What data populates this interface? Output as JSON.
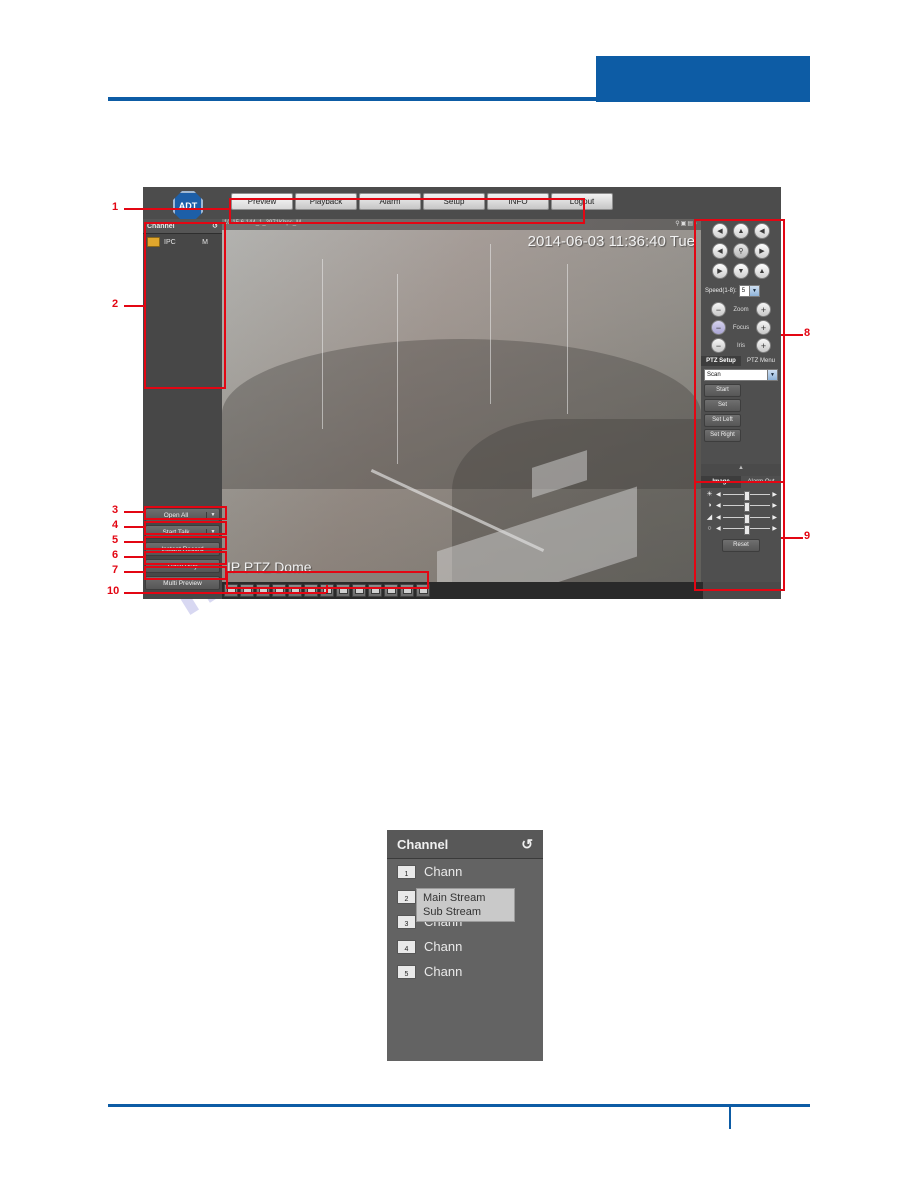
{
  "page": {
    "watermark": "manualslib.com"
  },
  "app": {
    "logo": "ADT",
    "tabs": [
      {
        "label": "Preview",
        "active": true
      },
      {
        "label": "Playback",
        "active": false
      },
      {
        "label": "Alarm",
        "active": false
      },
      {
        "label": "Setup",
        "active": false
      },
      {
        "label": "INFO",
        "active": false
      },
      {
        "label": "Logout",
        "active": false
      }
    ],
    "channel_panel": {
      "title": "Channel",
      "refresh_icon": "refresh-icon",
      "rows": [
        {
          "name": "IPC",
          "mode": "M"
        }
      ]
    },
    "left_buttons": [
      {
        "label": "Open All",
        "has_arrow": true
      },
      {
        "label": "Start Talk",
        "has_arrow": true
      },
      {
        "label": "Instant Record",
        "has_arrow": false
      },
      {
        "label": "Local Play",
        "has_arrow": false
      },
      {
        "label": "Multi Preview",
        "has_arrow": false
      }
    ],
    "video": {
      "stream_id": "10.15.6.144_1_3971Kbps_M",
      "timestamp": "2014-06-03 11:36:40 Tue",
      "camera_name": "IP PTZ Dome",
      "control_icons": "search-icon zoom-icon record-icon audio-icon"
    },
    "layout_toolbar": {
      "icons": [
        "single-window-icon",
        "dual-window-icon",
        "fullscreen-icon",
        "one-split-icon",
        "four-split-icon",
        "six-split-icon",
        "eight-split-icon",
        "nine-split-icon",
        "thirteen-split-icon",
        "sixteen-split-icon",
        "twenty-split-icon",
        "twentyfive-split-icon",
        "thirtysix-split-icon"
      ]
    },
    "ptz": {
      "pad": [
        [
          "arrow-up-left-icon",
          "arrow-up-icon",
          "arrow-up-right-icon"
        ],
        [
          "arrow-left-icon",
          "zoom-area-icon",
          "arrow-right-icon"
        ],
        [
          "arrow-down-left-icon",
          "arrow-down-icon",
          "arrow-down-right-icon"
        ]
      ],
      "speed_label": "Speed(1-8):",
      "speed_value": "5",
      "controls": [
        {
          "label": "Zoom",
          "minus": "−",
          "plus": "+"
        },
        {
          "label": "Focus",
          "minus": "−",
          "plus": "+"
        },
        {
          "label": "Iris",
          "minus": "−",
          "plus": "+"
        }
      ],
      "tabs": [
        {
          "label": "PTZ Setup",
          "active": true
        },
        {
          "label": "PTZ Menu",
          "active": false
        }
      ],
      "function_value": "Scan",
      "buttons": [
        "Start",
        "Set",
        "Set Left",
        "Set Right"
      ]
    },
    "image_panel": {
      "tabs": [
        {
          "label": "Image",
          "active": true
        },
        {
          "label": "Alarm Out",
          "active": false
        }
      ],
      "sliders": [
        {
          "icon": "brightness-icon",
          "glyph": "☀"
        },
        {
          "icon": "contrast-icon",
          "glyph": "◑"
        },
        {
          "icon": "saturation-icon",
          "glyph": "◢"
        },
        {
          "icon": "hue-icon",
          "glyph": "○"
        }
      ],
      "reset_label": "Reset"
    }
  },
  "callouts": [
    {
      "num": "1"
    },
    {
      "num": "2"
    },
    {
      "num": "3"
    },
    {
      "num": "4"
    },
    {
      "num": "5"
    },
    {
      "num": "6"
    },
    {
      "num": "7"
    },
    {
      "num": "8"
    },
    {
      "num": "9"
    },
    {
      "num": "10"
    }
  ],
  "inset": {
    "title": "Channel",
    "refresh_icon": "refresh-icon",
    "rows": [
      {
        "num": "1",
        "label": "Chann"
      },
      {
        "num": "2",
        "label": "Chann"
      },
      {
        "num": "3",
        "label": "Chann"
      },
      {
        "num": "4",
        "label": "Chann"
      },
      {
        "num": "5",
        "label": "Chann"
      }
    ],
    "context_menu": [
      "Main Stream",
      "Sub Stream"
    ]
  },
  "colors": {
    "accent_blue": "#0d5ca5",
    "annotation_red": "#e30613",
    "watermark": "#d8d8f2"
  }
}
